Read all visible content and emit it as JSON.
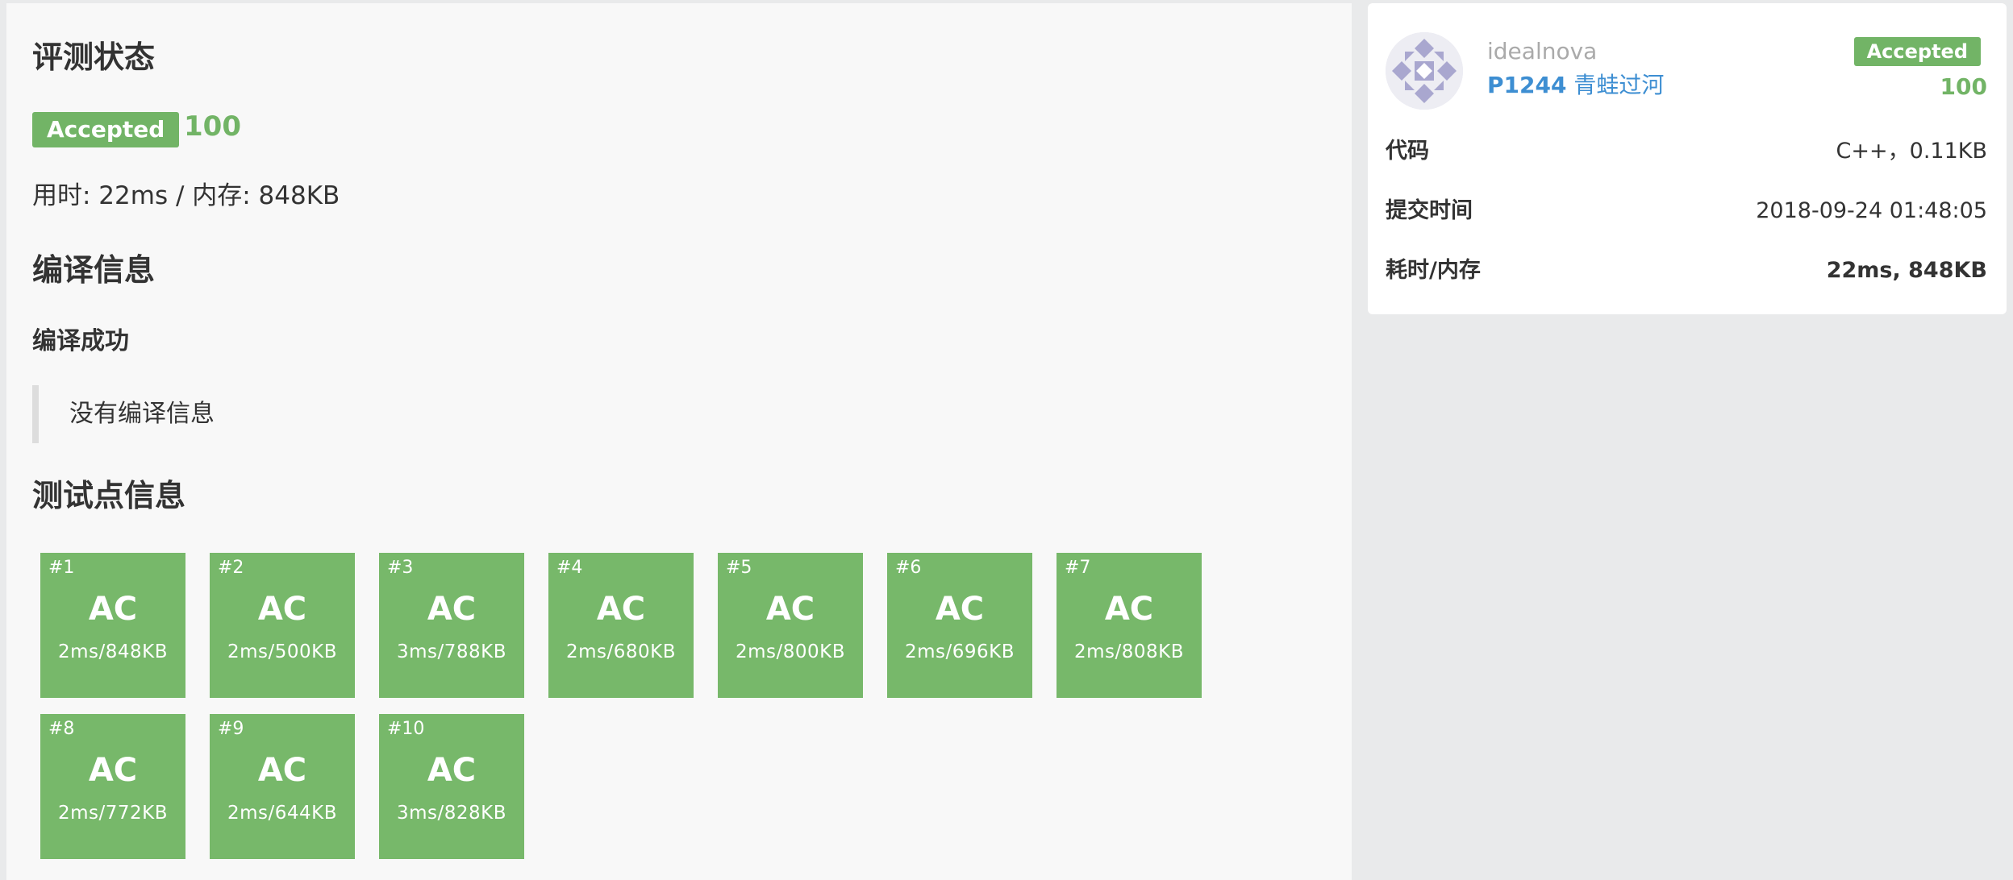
{
  "main": {
    "status_heading": "评测状态",
    "status_badge": "Accepted",
    "score": "100",
    "usage": "用时: 22ms / 内存: 848KB",
    "compile_heading": "编译信息",
    "compile_result": "编译成功",
    "compile_message": "没有编译信息",
    "testcase_heading": "测试点信息",
    "testcases": [
      {
        "id": "#1",
        "status": "AC",
        "usage": "2ms/848KB"
      },
      {
        "id": "#2",
        "status": "AC",
        "usage": "2ms/500KB"
      },
      {
        "id": "#3",
        "status": "AC",
        "usage": "3ms/788KB"
      },
      {
        "id": "#4",
        "status": "AC",
        "usage": "2ms/680KB"
      },
      {
        "id": "#5",
        "status": "AC",
        "usage": "2ms/800KB"
      },
      {
        "id": "#6",
        "status": "AC",
        "usage": "2ms/696KB"
      },
      {
        "id": "#7",
        "status": "AC",
        "usage": "2ms/808KB"
      },
      {
        "id": "#8",
        "status": "AC",
        "usage": "2ms/772KB"
      },
      {
        "id": "#9",
        "status": "AC",
        "usage": "2ms/644KB"
      },
      {
        "id": "#10",
        "status": "AC",
        "usage": "3ms/828KB"
      }
    ]
  },
  "sidebar": {
    "username": "idealnova",
    "problem_id": "P1244",
    "problem_title": "青蛙过河",
    "status_badge": "Accepted",
    "score": "100",
    "rows": [
      {
        "label": "代码",
        "value": "C++，0.11KB"
      },
      {
        "label": "提交时间",
        "value": "2018-09-24 01:48:05"
      },
      {
        "label": "耗时/内存",
        "value": "22ms, 848KB"
      }
    ]
  },
  "colors": {
    "accent_green": "#72b466",
    "testcase_green": "#77b86a",
    "link_blue": "#3d8ed2",
    "avatar_purple": "#a9a7cf"
  }
}
